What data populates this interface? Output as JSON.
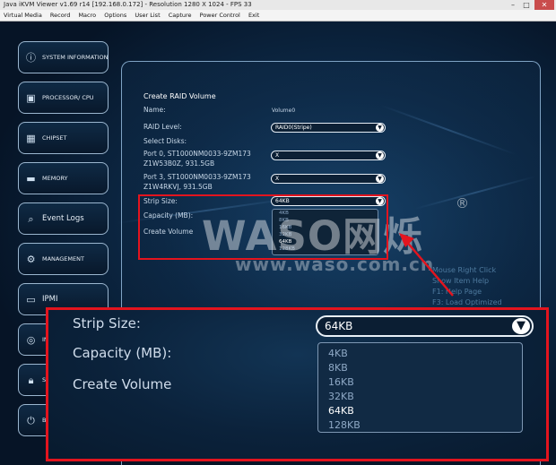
{
  "window": {
    "title": "Java iKVM Viewer v1.69 r14 [192.168.0.172]  - Resolution 1280 X 1024 - FPS 33"
  },
  "menu": [
    "Virtual Media",
    "Record",
    "Macro",
    "Options",
    "User List",
    "Capture",
    "Power Control",
    "Exit"
  ],
  "sidebar": [
    {
      "label": "SYSTEM INFORMATION",
      "icon": "info-icon"
    },
    {
      "label": "PROCESSOR/ CPU",
      "icon": "processor-icon"
    },
    {
      "label": "CHIPSET",
      "icon": "chipset-icon"
    },
    {
      "label": "MEMORY",
      "icon": "memory-icon"
    },
    {
      "label": "Event Logs",
      "icon": "search-icon"
    },
    {
      "label": "MANAGEMENT",
      "icon": "gear-icon"
    },
    {
      "label": "IPMI",
      "icon": "computer-icon"
    },
    {
      "label": "IN",
      "icon": "globe-icon"
    },
    {
      "label": "SE",
      "icon": "lock-icon"
    },
    {
      "label": "BO",
      "icon": "power-icon"
    }
  ],
  "raid": {
    "heading": "Create RAID Volume",
    "name_label": "Name:",
    "name_value": "Volume0",
    "level_label": "RAID Level:",
    "level_value": "RAID0(Stripe)",
    "select_disks_label": "Select Disks:",
    "disk0_line1": "Port 0, ST1000NM0033-9ZM173",
    "disk0_line2": "Z1W53B0Z, 931.5GB",
    "disk0_value": "X",
    "disk3_line1": "Port 3, ST1000NM0033-9ZM173",
    "disk3_line2": "Z1W4RKVJ, 931.5GB",
    "disk3_value": "X",
    "strip_label": "Strip Size:",
    "strip_value": "64KB",
    "capacity_label": "Capacity (MB):",
    "create_label": "Create Volume",
    "strip_options": [
      "4KB",
      "8KB",
      "16KB",
      "32KB",
      "64KB",
      "128KB"
    ],
    "strip_selected": "64KB"
  },
  "help": [
    "Mouse Right Click",
    "Show Item Help",
    "F1: Help Page",
    "F3: Load Optimized"
  ],
  "watermark": {
    "brand": "WASO",
    "cn": "网烁",
    "reg": "®",
    "url": "www.waso.com.cn"
  },
  "colors": {
    "highlight": "#e3141e",
    "background": "#0d2a48"
  }
}
